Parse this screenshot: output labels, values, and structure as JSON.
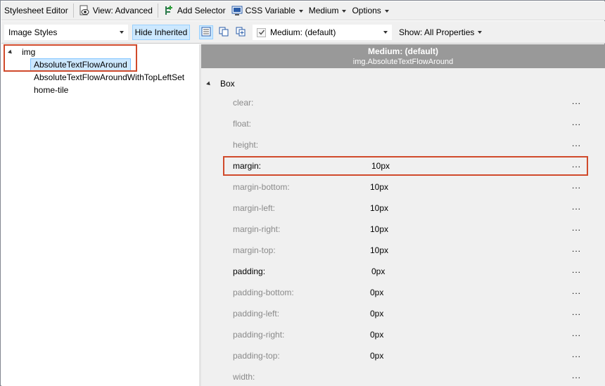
{
  "toolbar1": {
    "editor_label": "Stylesheet Editor",
    "view_label": "View: Advanced",
    "add_selector_label": "Add Selector",
    "css_variable_label": "CSS Variable",
    "medium_label": "Medium",
    "options_label": "Options"
  },
  "toolbar2": {
    "styles_select": "Image Styles",
    "hide_inherited_label": "Hide Inherited",
    "medium_select": "Medium: (default)",
    "show_label": "Show: All Properties"
  },
  "tree": {
    "root": "img",
    "children": [
      {
        "label": "AbsoluteTextFlowAround",
        "selected": true
      },
      {
        "label": "AbsoluteTextFlowAroundWithTopLeftSet",
        "selected": false
      },
      {
        "label": "home-tile",
        "selected": false
      }
    ]
  },
  "grid": {
    "header_title": "Medium: (default)",
    "header_subtitle": "img.AbsoluteTextFlowAround",
    "category": "Box",
    "ellipsis": "...",
    "properties": [
      {
        "name": "clear",
        "value": "",
        "set": false
      },
      {
        "name": "float",
        "value": "",
        "set": false
      },
      {
        "name": "height",
        "value": "",
        "set": false
      },
      {
        "name": "margin",
        "value": "10px",
        "set": true
      },
      {
        "name": "margin-bottom",
        "value": "10px",
        "set": false
      },
      {
        "name": "margin-left",
        "value": "10px",
        "set": false
      },
      {
        "name": "margin-right",
        "value": "10px",
        "set": false
      },
      {
        "name": "margin-top",
        "value": "10px",
        "set": false
      },
      {
        "name": "padding",
        "value": "0px",
        "set": true
      },
      {
        "name": "padding-bottom",
        "value": "0px",
        "set": false
      },
      {
        "name": "padding-left",
        "value": "0px",
        "set": false
      },
      {
        "name": "padding-right",
        "value": "0px",
        "set": false
      },
      {
        "name": "padding-top",
        "value": "0px",
        "set": false
      },
      {
        "name": "width",
        "value": "",
        "set": false
      }
    ]
  },
  "colors": {
    "highlight": "#d04a2b",
    "selection": "#cce8ff",
    "header_bg": "#999999"
  }
}
